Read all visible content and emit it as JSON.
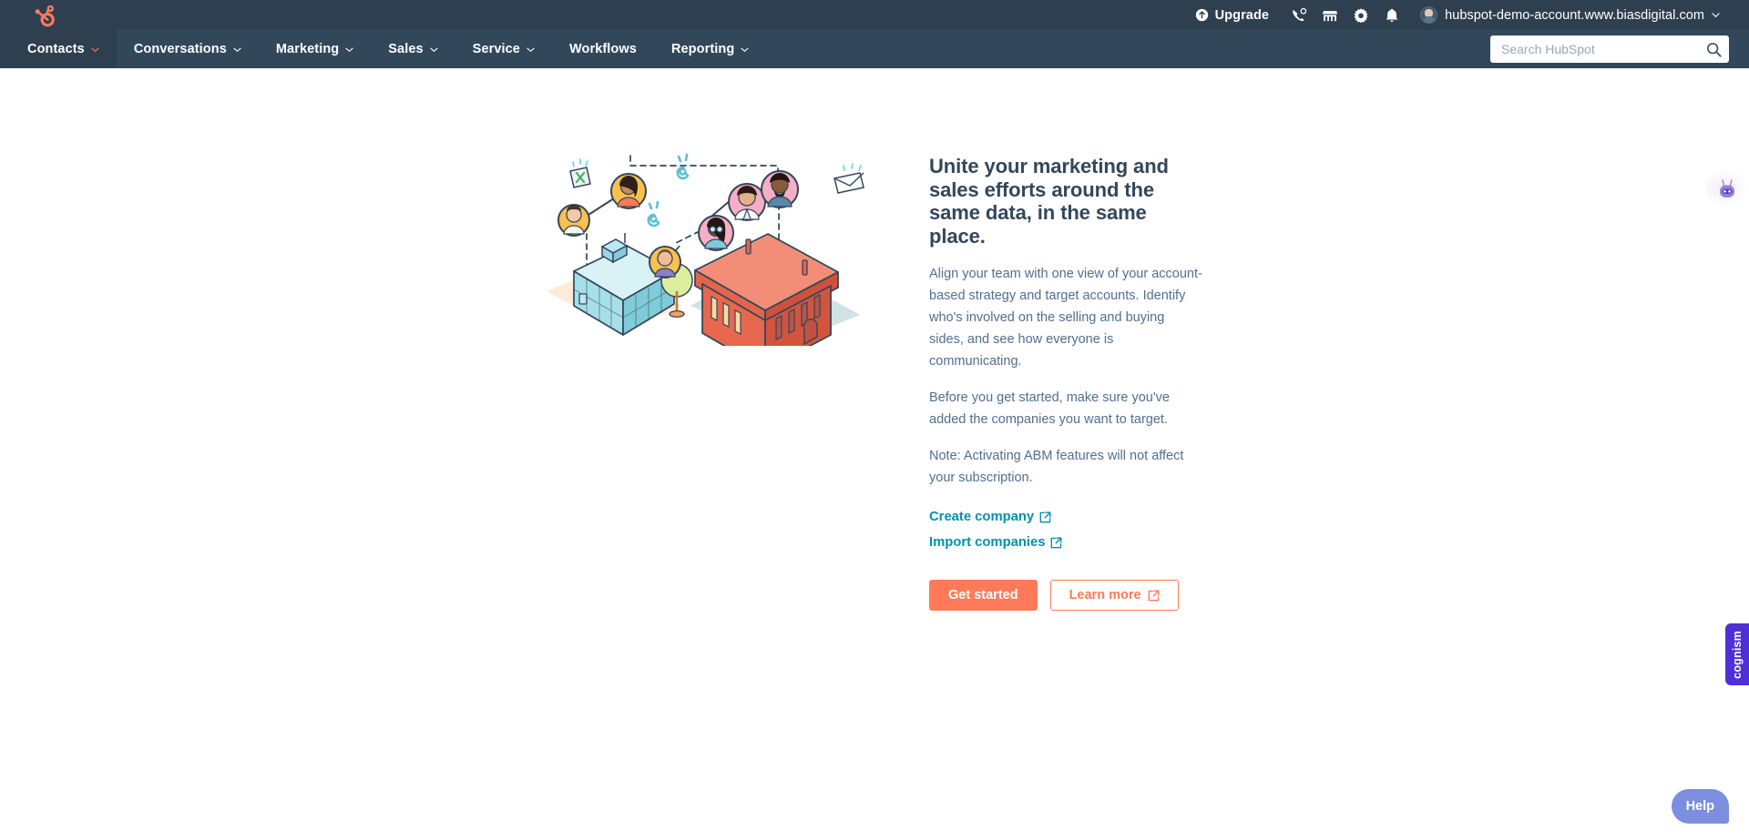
{
  "topbar": {
    "logo": "hubspot-sprocket-logo",
    "upgrade_label": "Upgrade",
    "upgrade_icon": "upgrade-arrow-icon",
    "icons": [
      {
        "name": "phone-call-icon",
        "label": "Calling"
      },
      {
        "name": "marketplace-storefront-icon",
        "label": "Marketplace"
      },
      {
        "name": "gear-icon",
        "label": "Settings"
      },
      {
        "name": "bell-notification-icon",
        "label": "Notifications"
      }
    ],
    "account_name": "hubspot-demo-account.www.biasdigital.com",
    "account_chevron_icon": "chevron-down-icon",
    "avatar": "user-avatar"
  },
  "nav": {
    "items": [
      {
        "label": "Contacts",
        "has_chevron": true,
        "active": true
      },
      {
        "label": "Conversations",
        "has_chevron": true,
        "active": false
      },
      {
        "label": "Marketing",
        "has_chevron": true,
        "active": false
      },
      {
        "label": "Sales",
        "has_chevron": true,
        "active": false
      },
      {
        "label": "Service",
        "has_chevron": true,
        "active": false
      },
      {
        "label": "Workflows",
        "has_chevron": false,
        "active": false
      },
      {
        "label": "Reporting",
        "has_chevron": true,
        "active": false
      }
    ]
  },
  "search": {
    "placeholder": "Search HubSpot",
    "value": "",
    "icon": "search-icon"
  },
  "hero": {
    "illustration": "two-office-buildings-with-connected-people-avatars",
    "headline": "Unite your marketing and sales efforts around the same data, in the same place.",
    "paragraph_1": "Align your team with one view of your account-based strategy and target accounts. Identify who's involved on the selling and buying sides, and see how everyone is communicating.",
    "paragraph_2": "Before you get started, make sure you've added the companies you want to target.",
    "paragraph_3": "Note: Activating ABM features will not affect your subscription.",
    "links": [
      {
        "label": "Create company",
        "icon": "external-link-icon"
      },
      {
        "label": "Import companies",
        "icon": "external-link-icon"
      }
    ],
    "buttons": {
      "primary_label": "Get started",
      "secondary_label": "Learn more",
      "secondary_icon": "external-link-icon"
    }
  },
  "widgets": {
    "bot_badge": "robot-assistant-icon",
    "cognism_tab_label": "cognism",
    "help_label": "Help"
  },
  "colors": {
    "topbar_bg": "#2e3f50",
    "navbar_bg": "#33475b",
    "accent_orange": "#ff7a59",
    "link_teal": "#0091ae",
    "heading": "#33475b",
    "body_text": "#516f90",
    "cognism_purple": "#4f2fd7",
    "help_blue": "#7c8ee0"
  }
}
